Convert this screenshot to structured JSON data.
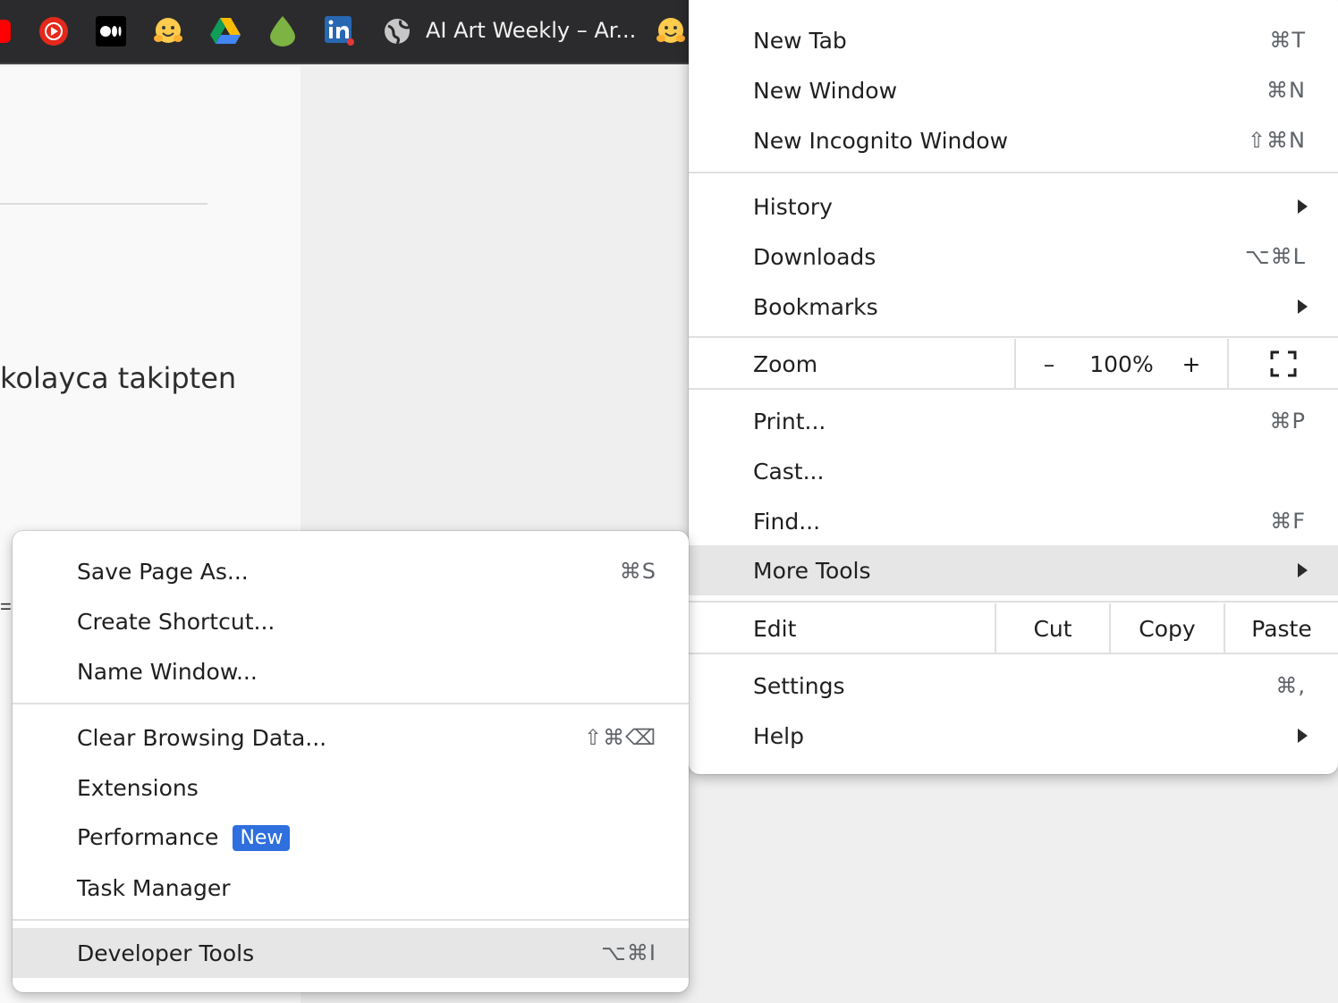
{
  "bookmarks_bar": {
    "items": [
      {
        "icon": "youtube-icon"
      },
      {
        "icon": "youtube-music-icon"
      },
      {
        "icon": "medium-icon"
      },
      {
        "icon": "hugging-face-icon"
      },
      {
        "icon": "google-drive-icon"
      },
      {
        "icon": "drop-icon"
      },
      {
        "icon": "linkedin-icon"
      },
      {
        "icon": "globe-icon"
      },
      {
        "icon": "hugging-face-icon"
      }
    ],
    "page_title": "AI Art Weekly – Ar..."
  },
  "page": {
    "text": "kolayca takipten",
    "fragment": "="
  },
  "main_menu": {
    "new_tab": {
      "label": "New Tab",
      "shortcut": "⌘T"
    },
    "new_window": {
      "label": "New Window",
      "shortcut": "⌘N"
    },
    "new_incognito": {
      "label": "New Incognito Window",
      "shortcut": "⇧⌘N"
    },
    "history": {
      "label": "History"
    },
    "downloads": {
      "label": "Downloads",
      "shortcut": "⌥⌘L"
    },
    "bookmarks": {
      "label": "Bookmarks"
    },
    "zoom": {
      "label": "Zoom",
      "minus": "–",
      "value": "100%",
      "plus": "+"
    },
    "print": {
      "label": "Print...",
      "shortcut": "⌘P"
    },
    "cast": {
      "label": "Cast..."
    },
    "find": {
      "label": "Find...",
      "shortcut": "⌘F"
    },
    "more_tools": {
      "label": "More Tools"
    },
    "edit": {
      "label": "Edit",
      "cut": "Cut",
      "copy": "Copy",
      "paste": "Paste"
    },
    "settings": {
      "label": "Settings",
      "shortcut": "⌘,"
    },
    "help": {
      "label": "Help"
    }
  },
  "more_tools_menu": {
    "save_page": {
      "label": "Save Page As...",
      "shortcut": "⌘S"
    },
    "create_shortcut": {
      "label": "Create Shortcut..."
    },
    "name_window": {
      "label": "Name Window..."
    },
    "clear_browsing": {
      "label": "Clear Browsing Data...",
      "shortcut": "⇧⌘⌫"
    },
    "extensions": {
      "label": "Extensions"
    },
    "performance": {
      "label": "Performance",
      "badge": "New"
    },
    "task_manager": {
      "label": "Task Manager"
    },
    "developer_tools": {
      "label": "Developer Tools",
      "shortcut": "⌥⌘I"
    }
  },
  "colors": {
    "bookmarks_bar_bg": "#2b2b2d",
    "menu_bg": "#ffffff",
    "highlight": "#e6e6e6",
    "badge": "#2f6fde"
  }
}
